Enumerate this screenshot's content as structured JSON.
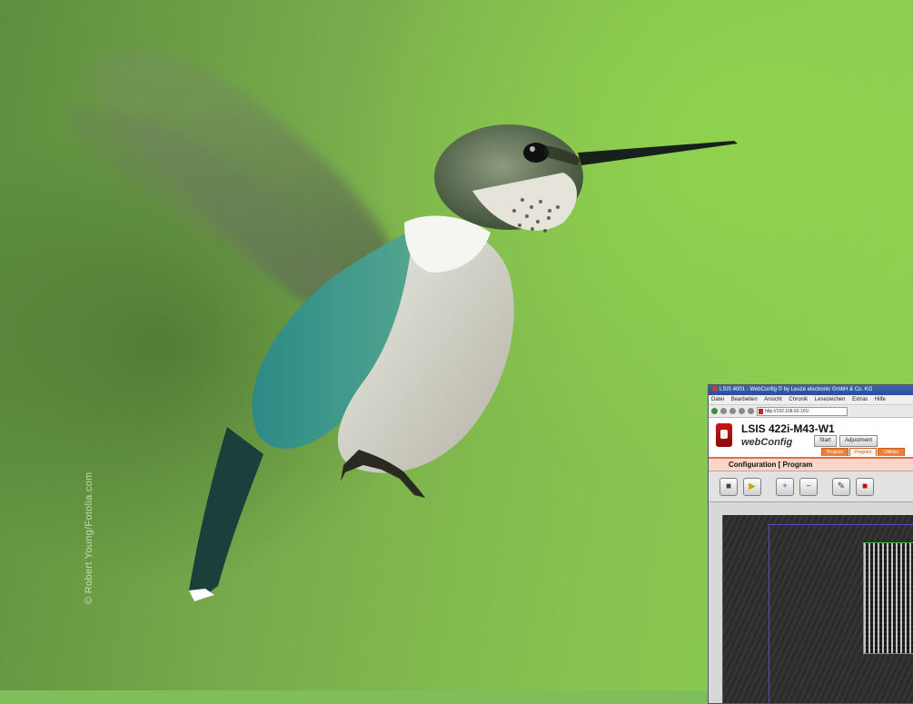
{
  "photo": {
    "credit": "© Robert Young/Fotolia.com"
  },
  "window": {
    "title": "LSIS 4001 - WebConfig © by Leuze electronic GmbH & Co. KG",
    "menu": [
      "Datei",
      "Bearbeiten",
      "Ansicht",
      "Chronik",
      "Lesezeichen",
      "Extras",
      "Hilfe"
    ],
    "url": "http://192.168.60.101/"
  },
  "app": {
    "model": "LSIS 422i-M43-W1",
    "brand_web": "web",
    "brand_config": "Config",
    "buttons": {
      "start": "Start",
      "adjustment": "Adjustment"
    },
    "tabs": [
      "Projects",
      "Program",
      "Utilities"
    ],
    "config_title": "Configuration [ Program"
  },
  "toolbar": {
    "icons": [
      "camera-icon",
      "play-icon",
      "zoom-in-icon",
      "zoom-out-icon",
      "tools-icon",
      "export-icon"
    ]
  }
}
